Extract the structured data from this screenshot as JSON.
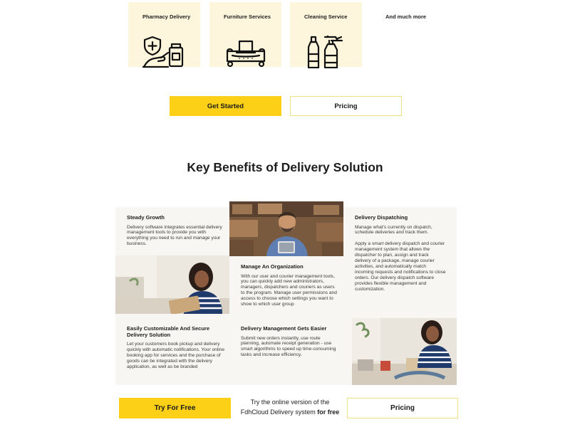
{
  "services": [
    {
      "label": "Pharmacy Delivery",
      "icon": "pharmacy-icon"
    },
    {
      "label": "Furniture Services",
      "icon": "sofa-icon"
    },
    {
      "label": "Cleaning Service",
      "icon": "cleaning-bottles-icon"
    }
  ],
  "services_more": "And much more",
  "cta_top": {
    "primary": "Get Started",
    "secondary": "Pricing"
  },
  "benefits": {
    "heading": "Key Benefits of Delivery Solution",
    "steady": {
      "title": "Steady Growth",
      "text": "Delivery software integrates essential delivery management tools to provide you with everything you need to run and manage your business."
    },
    "dispatching": {
      "title": "Delivery Dispatching",
      "text1": "Manage what's currently on dispatch, schedule deliveries and track them.",
      "text2": "Apply a smart delivery dispatch and courier management system that allows the dispatcher to plan, assign and track delivery of a package, manage courier activities, and automatically match incoming requests and notifications to close orders. Our delivery dispatch software provides flexible management and customization."
    },
    "organization": {
      "title": "Manage An Organization",
      "text": "With our user and courier management tools, you can quickly add new administrators, managers, dispatchers and couriers as users to the program. Manage user permissions and access to choose which settings you want to show to which user group"
    },
    "customizable": {
      "title": "Easily Customizable And Secure Delivery Solution",
      "text": "Let your customers book pickup and delivery quickly with automatic notifications. Your online booking app for services and the purchase of goods can be integrated with the delivery application, as well as be branded"
    },
    "easier": {
      "title": "Delivery Management Gets Easier",
      "text": "Submit new orders instantly, use route planning, automate receipt generation - use smart algorithms to speed up time-consuming tasks and increase efficiency."
    }
  },
  "cta_bottom": {
    "primary": "Try For Free",
    "promo_line1": "Try the online version of the",
    "promo_line2": "FdhCloud Delivery system",
    "promo_bold": "for free",
    "secondary": "Pricing"
  },
  "colors": {
    "accent": "#fbd016",
    "card_bg": "#fdf5dc",
    "panel_bg": "#f7f6f3"
  }
}
